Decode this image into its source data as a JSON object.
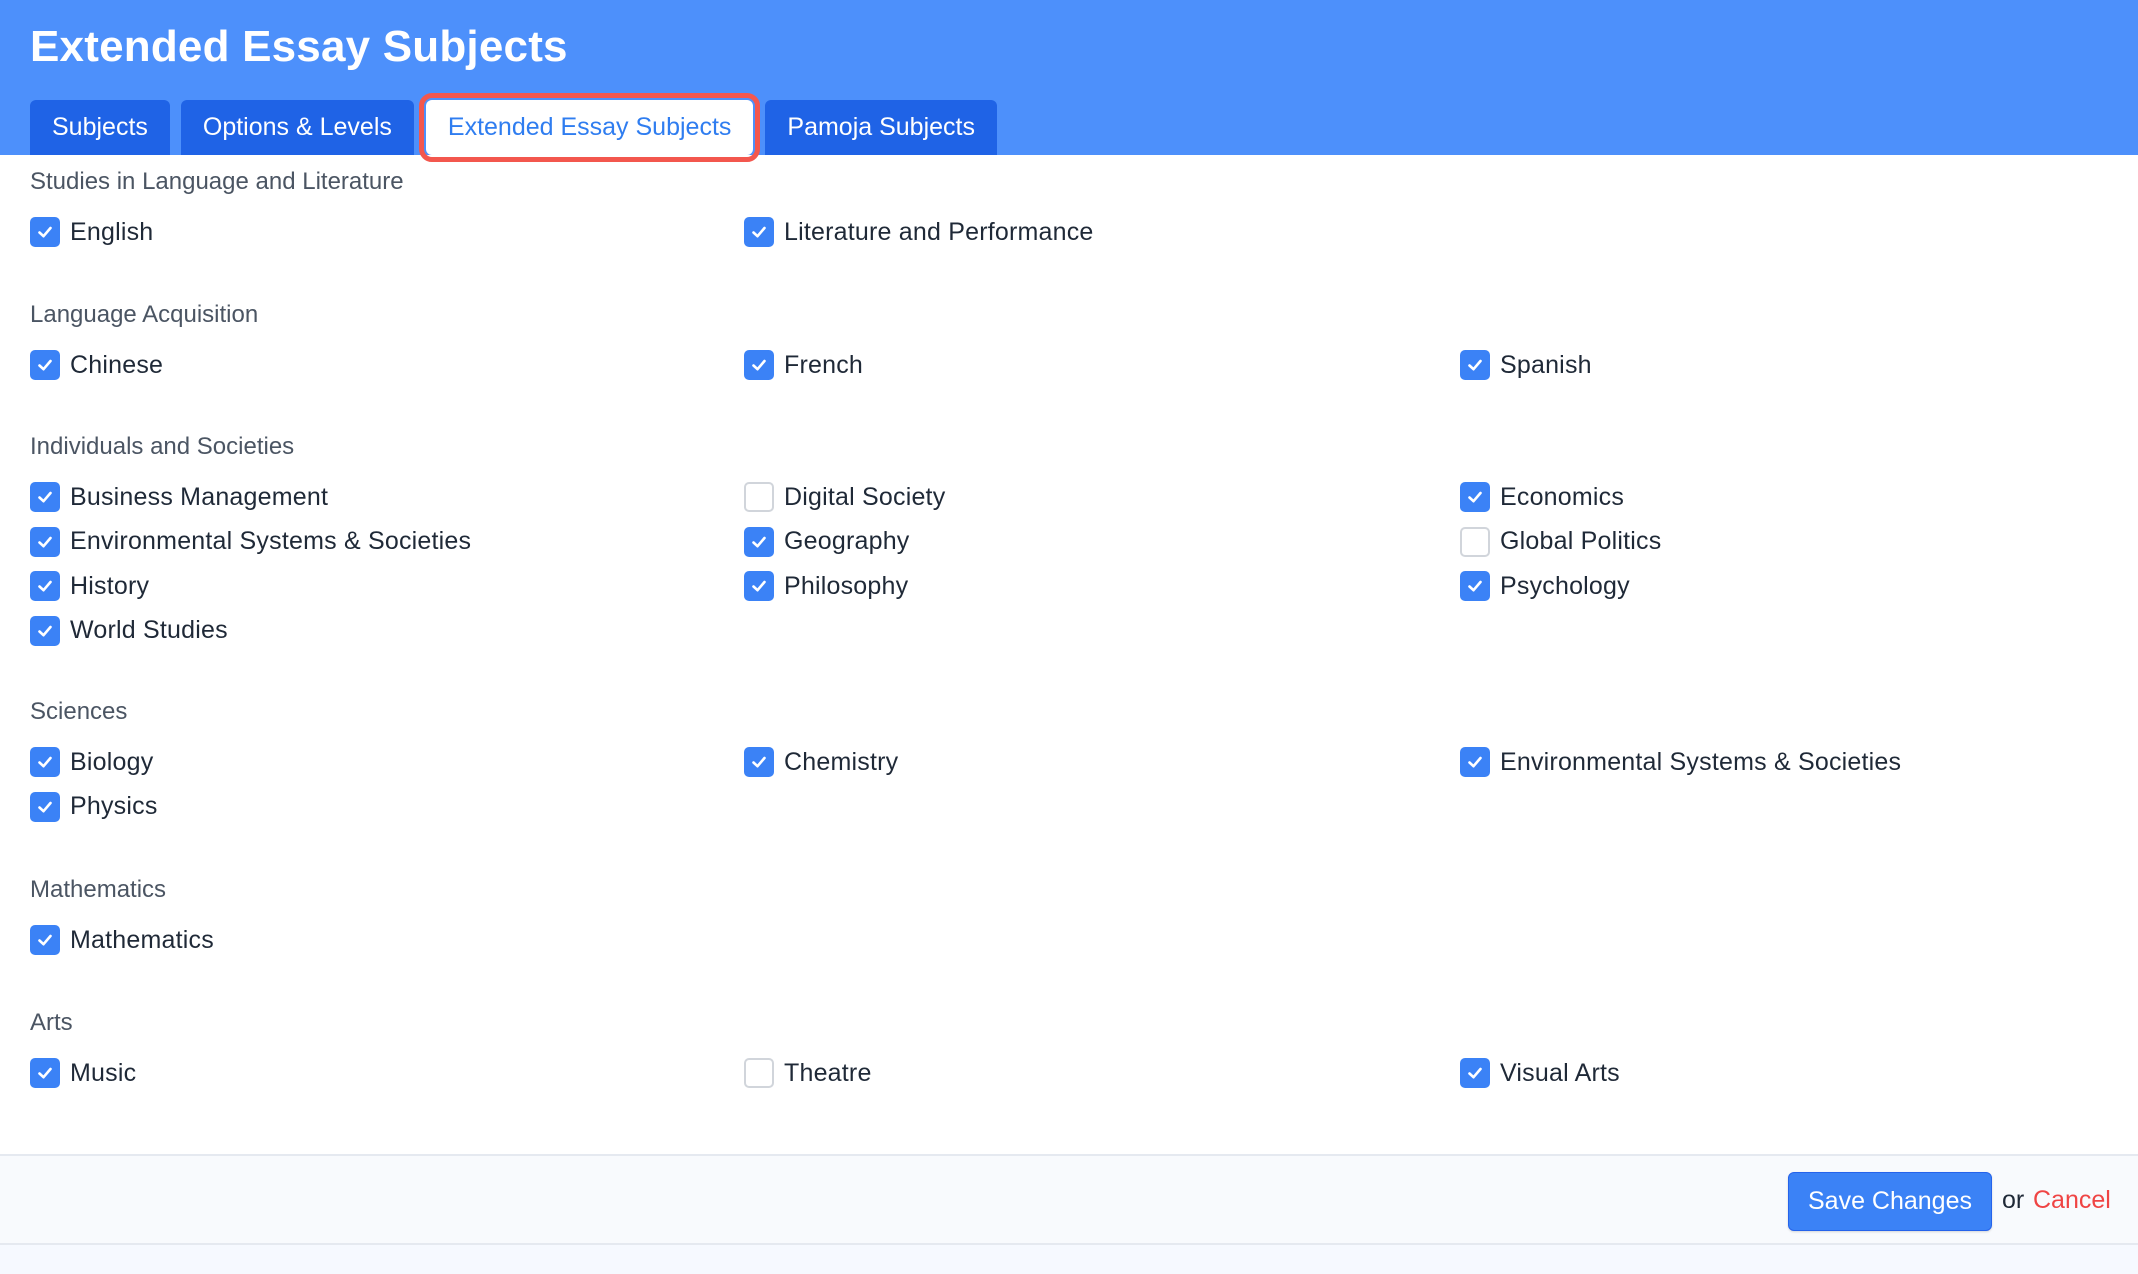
{
  "header": {
    "title": "Extended Essay Subjects",
    "tabs": [
      {
        "label": "Subjects",
        "active": false
      },
      {
        "label": "Options & Levels",
        "active": false
      },
      {
        "label": "Extended Essay Subjects",
        "active": true
      },
      {
        "label": "Pamoja Subjects",
        "active": false
      }
    ]
  },
  "sections": [
    {
      "heading": "Studies in Language and Literature",
      "items": [
        {
          "label": "English",
          "checked": true
        },
        {
          "label": "Literature and Performance",
          "checked": true
        }
      ]
    },
    {
      "heading": "Language Acquisition",
      "items": [
        {
          "label": "Chinese",
          "checked": true
        },
        {
          "label": "French",
          "checked": true
        },
        {
          "label": "Spanish",
          "checked": true
        }
      ]
    },
    {
      "heading": "Individuals and Societies",
      "items": [
        {
          "label": "Business Management",
          "checked": true
        },
        {
          "label": "Digital Society",
          "checked": false
        },
        {
          "label": "Economics",
          "checked": true
        },
        {
          "label": "Environmental Systems & Societies",
          "checked": true
        },
        {
          "label": "Geography",
          "checked": true
        },
        {
          "label": "Global Politics",
          "checked": false
        },
        {
          "label": "History",
          "checked": true
        },
        {
          "label": "Philosophy",
          "checked": true
        },
        {
          "label": "Psychology",
          "checked": true
        },
        {
          "label": "World Studies",
          "checked": true
        }
      ]
    },
    {
      "heading": "Sciences",
      "items": [
        {
          "label": "Biology",
          "checked": true
        },
        {
          "label": "Chemistry",
          "checked": true
        },
        {
          "label": "Environmental Systems & Societies",
          "checked": true
        },
        {
          "label": "Physics",
          "checked": true
        }
      ]
    },
    {
      "heading": "Mathematics",
      "items": [
        {
          "label": "Mathematics",
          "checked": true
        }
      ]
    },
    {
      "heading": "Arts",
      "items": [
        {
          "label": "Music",
          "checked": true
        },
        {
          "label": "Theatre",
          "checked": false
        },
        {
          "label": "Visual Arts",
          "checked": true
        }
      ]
    }
  ],
  "footer": {
    "save_label": "Save Changes",
    "or_text": "or",
    "cancel_label": "Cancel"
  },
  "colors": {
    "header_bg": "#4d90fb",
    "tab_bg": "#1f63e6",
    "active_tab_highlight": "#f3574e",
    "checkbox_checked": "#3b82f6",
    "cancel_link": "#ef4444"
  }
}
